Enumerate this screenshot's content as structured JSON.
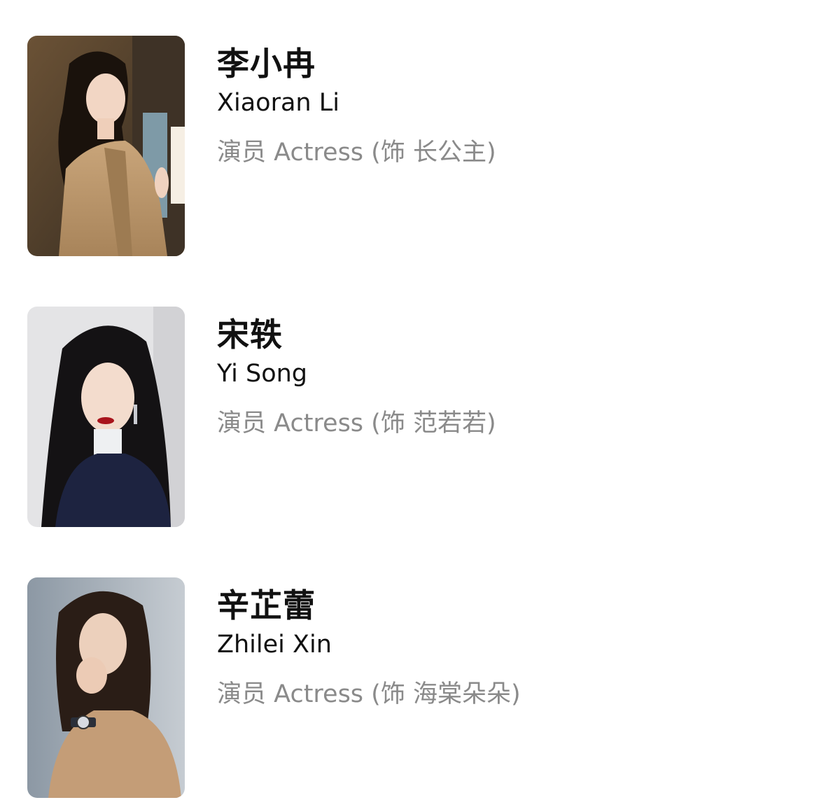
{
  "cast": [
    {
      "name_cn": "李小冉",
      "name_en": "Xiaoran Li",
      "role": "演员 Actress (饰 长公主)",
      "photo_icon": "portrait-photo"
    },
    {
      "name_cn": "宋轶",
      "name_en": "Yi Song",
      "role": "演员 Actress (饰 范若若)",
      "photo_icon": "portrait-photo"
    },
    {
      "name_cn": "辛芷蕾",
      "name_en": "Zhilei Xin",
      "role": "演员 Actress (饰 海棠朵朵)",
      "photo_icon": "portrait-photo"
    }
  ],
  "colors": {
    "name": "#111111",
    "role": "#8a8a8a",
    "background": "#ffffff"
  }
}
